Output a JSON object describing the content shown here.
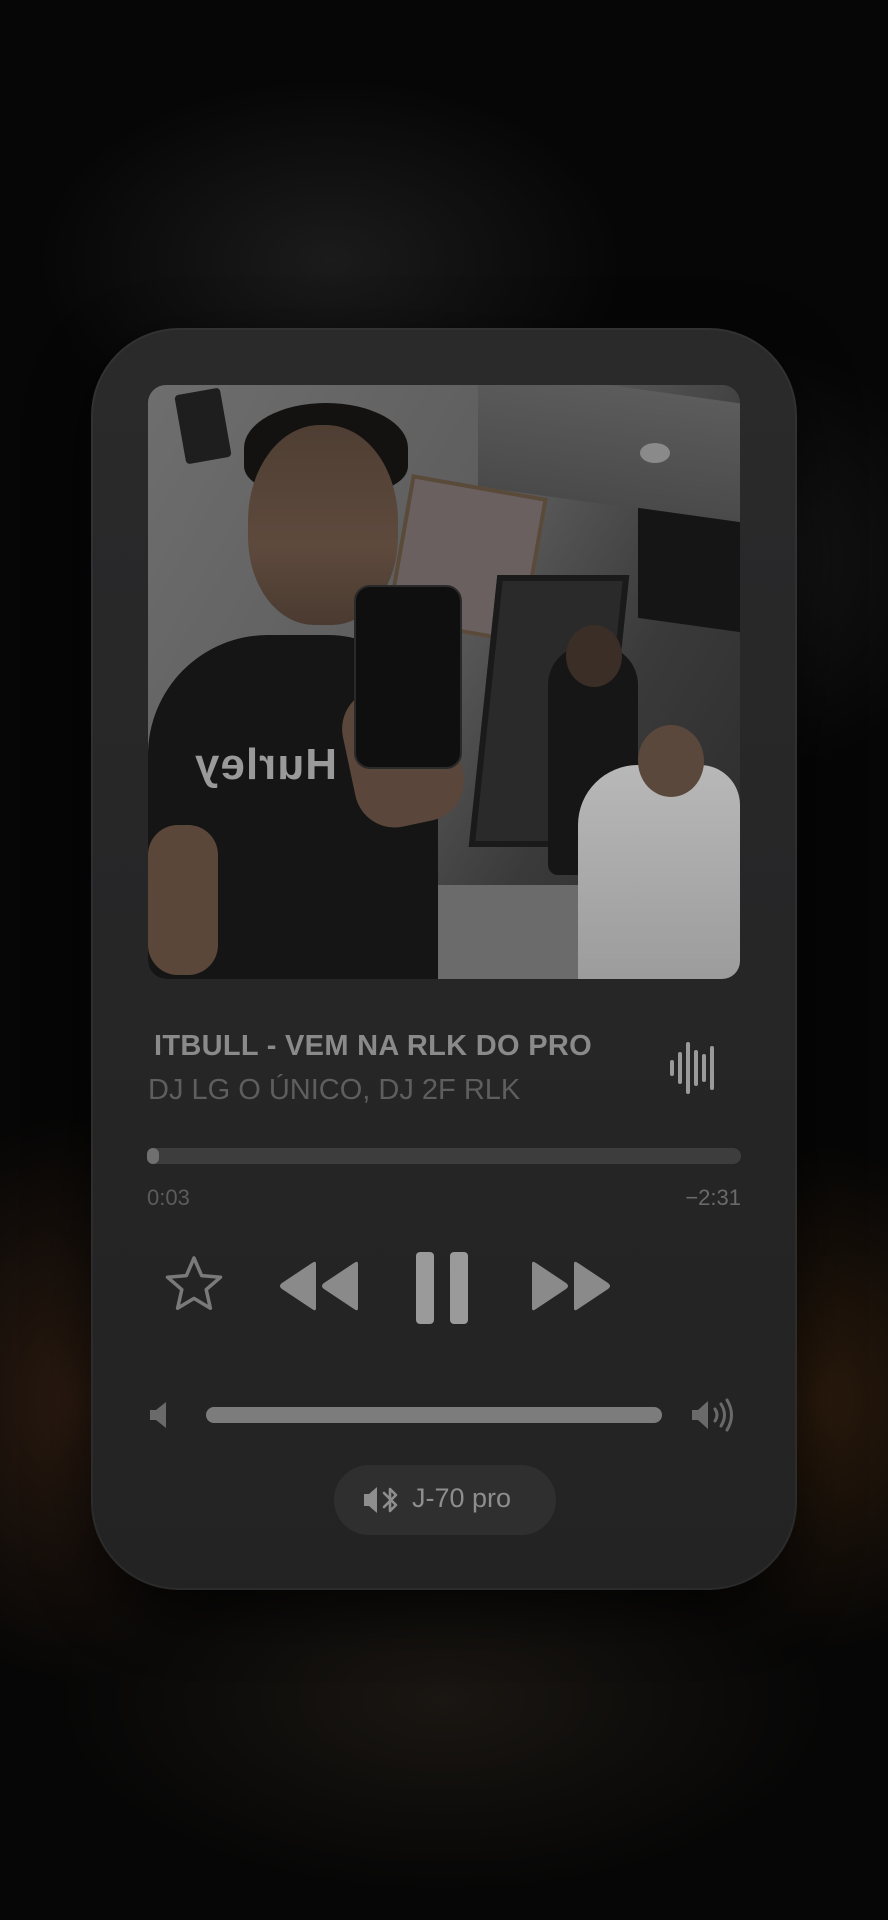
{
  "now_playing": {
    "title": "ITBULL - VEM NA RLK DO PRO",
    "artist": "DJ LG O ÚNICO, DJ 2F RLK",
    "artwork_logo_text": "Hurley",
    "playback_state": "playing"
  },
  "progress": {
    "elapsed": "0:03",
    "remaining": "−2:31",
    "fraction": 0.02
  },
  "controls": {
    "favorite_icon": "star-icon",
    "rewind_icon": "rewind-icon",
    "pause_icon": "pause-icon",
    "forward_icon": "fast-forward-icon"
  },
  "volume": {
    "level": 1.0,
    "low_icon": "speaker-low-icon",
    "high_icon": "speaker-high-icon"
  },
  "output_device": {
    "icon": "bluetooth-speaker-icon",
    "label": "J-70 pro"
  },
  "colors": {
    "card": "#262627",
    "accent_text": "#8a8a8a",
    "track": "#3d3d3e"
  }
}
